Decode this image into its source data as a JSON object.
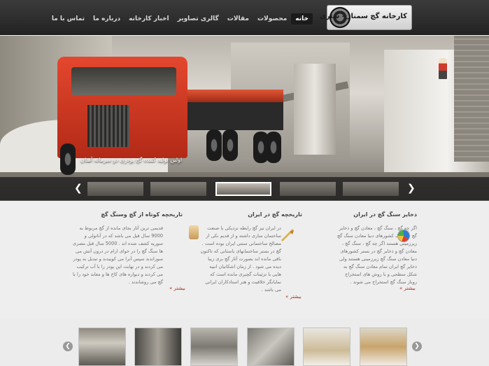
{
  "header": {
    "logo_text": "کارخانه گچ سمنان- ساری",
    "nav": [
      "خانه",
      "محصولات",
      "مقالات",
      "گالری تصاویر",
      "اخبار کارخانه",
      "درباره ما",
      "تماس با ما"
    ]
  },
  "hero": {
    "caption": "اولین تولید کننده گچ پودری دو سرمانه آهنان"
  },
  "columns": [
    {
      "title": "ذخایر سنگ گچ در ایران",
      "text": "اگر چه گچ ، سنگ گچ ، معادن گچ و ذخایر گچ در سنگ کشورهای دنیا معادن سنگ گچ زیرزمینی هستند اگر چه گچ ، سنگ گچ ، معادن گچ و ذخایر گچ در بستر کشورهای دنیا معادن سنگ گچ زیرزمینی هستند ولی ذخایر گچ ایران تمام معادن سنگ گچ به شکل سطحی و با روش های استخراج روباز سنگ گچ استخراج می شوند .",
      "more": "بیشتر »"
    },
    {
      "title": "تاریخچه گچ در ایران",
      "text": "در ایران نیز گچ رابطه نزدیکی با صنعت ساختمان سازی داشته و از قدیم نکی از مصالح ساختمانی سنتی ایران بوده است . گچ در بستر ساختمانهای باستانی که تاکنون باقی مانده اند بصورت آثار گچ بری زیبا دیده می شود . از زمان اشکانیان انبیه هایی با تزئینات گچبری مانده است که نمایانگر خلاقیت و هنر استادکاران ایرانی می باشد .",
      "more": "بیشتر »"
    },
    {
      "title": "تاریخچه کوتاه از گچ وسنگ گچ",
      "text": "قدیمی ترین آثار بجای مانده از گچ مربوط به 9000 سال قبل می باشد که در آناتولی و سوریه کشف شده اند . 5000 سال قبل مصری ها سنگ گچ را در خوای ارام در درون آتش می سوزاندند سپس آنرا می کوبیدند و تبدیل به پودر می کردند و در نهایت این پودر را با آب ترکیب می کردند و دیواره های کاخ ها و معابد خود را با گچ می روشاندند .",
      "more": "بیشتر »"
    }
  ],
  "icons": {
    "globe": "pie-chart-icon",
    "pen": "quill-pen-icon",
    "scroll": "scroll-icon",
    "prev": "chevron-left-icon",
    "next": "chevron-right-icon"
  },
  "colors": {
    "header_bg": "#2d2d2d",
    "link_red": "#b0281b",
    "active_nav": "#1b1b1b"
  }
}
